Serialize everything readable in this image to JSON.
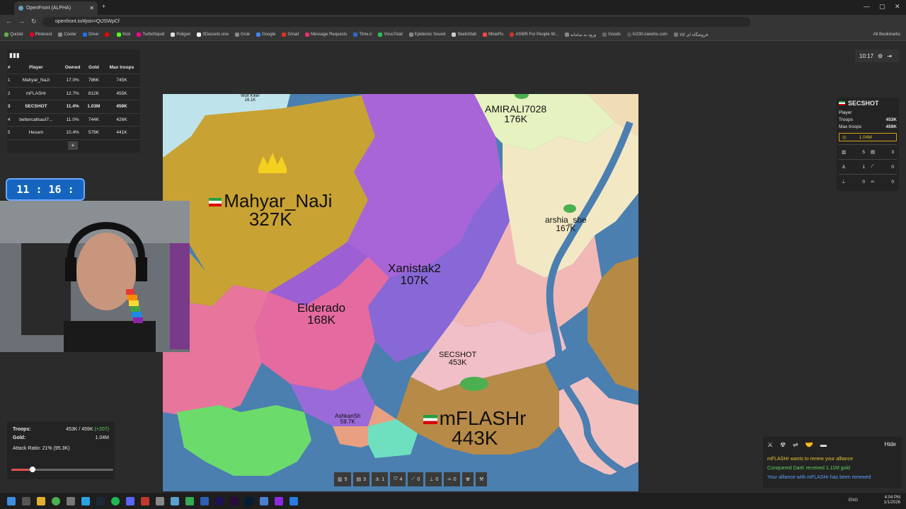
{
  "browser": {
    "tab_title": "OpenFront (ALPHA)",
    "url": "openfront.io/#join=QtJSWpCf",
    "bookmarks": [
      "Quizlet",
      "Pinterest",
      "Cooler",
      "Drive",
      "",
      "Kick",
      "TurboSquid",
      "Poligon",
      "3Dassets.one",
      "Grok",
      "Google",
      "Gmail",
      "Message Requests",
      "Time.ir",
      "VirusTotal",
      "Epidemic Sound",
      "Sketchfab",
      "MinePic",
      "ASMR For People W...",
      "ورود به سامانه",
      "Goods",
      "ln230.irandns.com",
      "فروشگاه ای کالا"
    ],
    "all_bookmarks": "All Bookmarks"
  },
  "leaderboard": {
    "headers": [
      "#",
      "Player",
      "Owned",
      "Gold",
      "Max troops"
    ],
    "rows": [
      [
        "1",
        "Mahyar_NaJi",
        "17.0%",
        "786K",
        "745K"
      ],
      [
        "2",
        "mFLASHr",
        "12.7%",
        "812K",
        "455K"
      ],
      [
        "3",
        "SECSHOT",
        "11.4%",
        "1.03M",
        "459K"
      ],
      [
        "4",
        "bettercallsaul7...",
        "11.0%",
        "744K",
        "426K"
      ],
      [
        "5",
        "Hesam",
        "10.4%",
        "579K",
        "441K"
      ]
    ],
    "plus": "+"
  },
  "clock": "11 : 16 : 08",
  "game_timer": "10:17",
  "player_panel": {
    "name": "SECSHOT",
    "type": "Player",
    "troops_label": "Troops",
    "troops": "453K",
    "max_troops_label": "Max troops",
    "max_troops": "459K",
    "gold": "1.04M",
    "buildings": [
      "5",
      "3",
      "1",
      "0",
      "0",
      "0"
    ]
  },
  "map_labels": [
    {
      "name": "Mahyar_NaJi",
      "troops": "327K"
    },
    {
      "name": "Xanistak2",
      "troops": "107K"
    },
    {
      "name": "Elderado",
      "troops": "168K"
    },
    {
      "name": "AMIRALI7028",
      "troops": "176K"
    },
    {
      "name": "arshia_sbe",
      "troops": "167K"
    },
    {
      "name": "SECSHOT",
      "troops": "453K"
    },
    {
      "name": "mFLASHr",
      "troops": "443K"
    },
    {
      "name": "AshkanSh",
      "troops": "59.7K"
    },
    {
      "name": "Wolf Killer",
      "troops": "16.1K"
    }
  ],
  "stats": {
    "troops_label": "Troops:",
    "troops": "453K / 459K",
    "troops_gain": "(+207)",
    "gold_label": "Gold:",
    "gold": "1.04M",
    "attack_ratio": "Attack Ratio: 21% (95.3K)",
    "attack_ratio_value": 0.21
  },
  "bottom_bar": [
    "5",
    "3",
    "1",
    "4",
    "0",
    "0",
    "0"
  ],
  "events": {
    "hide": "Hide",
    "messages": [
      {
        "text": "mFLASHr wants to renew your alliance",
        "color": "#e6c62e"
      },
      {
        "text": "Conquered DarK received 1.11M gold",
        "color": "#5fd35f"
      },
      {
        "text": "Your alliance with mFLASHr has been renewed",
        "color": "#5aa0ff"
      }
    ]
  },
  "taskbar": {
    "lang": "ENG",
    "time": "4:04 PM",
    "date": "1/1/2026"
  }
}
